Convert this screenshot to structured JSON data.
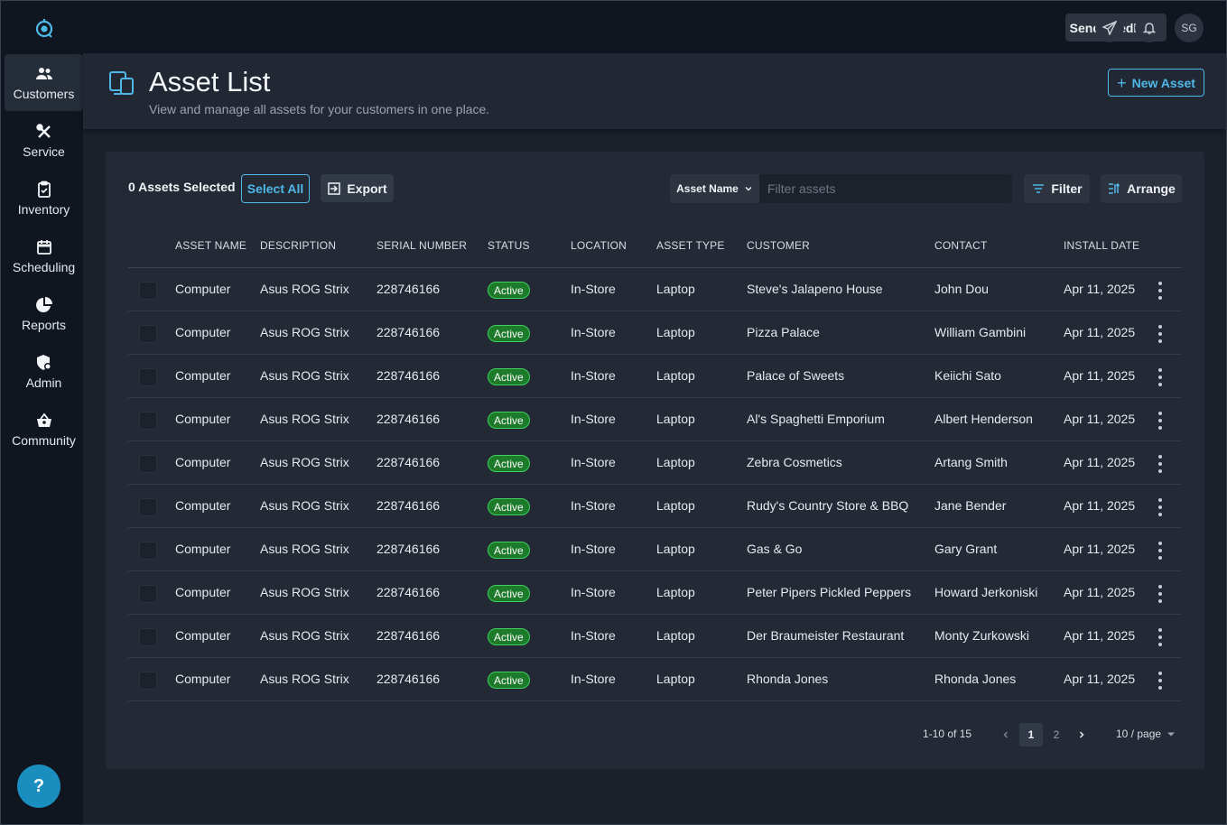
{
  "sidebar": {
    "items": [
      {
        "label": "Customers",
        "icon": "people-icon",
        "active": true
      },
      {
        "label": "Service",
        "icon": "tools-icon",
        "active": false
      },
      {
        "label": "Inventory",
        "icon": "clipboard-icon",
        "active": false
      },
      {
        "label": "Scheduling",
        "icon": "calendar-icon",
        "active": false
      },
      {
        "label": "Reports",
        "icon": "pie-chart-icon",
        "active": false
      },
      {
        "label": "Admin",
        "icon": "admin-gear-icon",
        "active": false
      },
      {
        "label": "Community",
        "icon": "basket-icon",
        "active": false
      }
    ],
    "help_label": "?"
  },
  "topbar": {
    "send_feedback": "Send Feedback",
    "avatar_initials": "SG"
  },
  "header": {
    "title": "Asset List",
    "subtitle": "View and manage all assets for your customers in one place.",
    "new_asset": "New Asset"
  },
  "toolbar": {
    "selected_count": "0 Assets Selected",
    "select_all": "Select All",
    "export": "Export",
    "search_field": "Asset Name",
    "search_placeholder": "Filter assets",
    "filter": "Filter",
    "arrange": "Arrange"
  },
  "table": {
    "columns": [
      "ASSET NAME",
      "DESCRIPTION",
      "SERIAL NUMBER",
      "STATUS",
      "LOCATION",
      "ASSET TYPE",
      "CUSTOMER",
      "CONTACT",
      "INSTALL DATE"
    ],
    "rows": [
      {
        "name": "Computer",
        "description": "Asus ROG Strix",
        "serial": "228746166",
        "status": "Active",
        "location": "In-Store",
        "type": "Laptop",
        "customer": "Steve's Jalapeno House",
        "contact": "John Dou",
        "date": "Apr 11, 2025"
      },
      {
        "name": "Computer",
        "description": "Asus ROG Strix",
        "serial": "228746166",
        "status": "Active",
        "location": "In-Store",
        "type": "Laptop",
        "customer": "Pizza Palace",
        "contact": "William Gambini",
        "date": "Apr 11, 2025"
      },
      {
        "name": "Computer",
        "description": "Asus ROG Strix",
        "serial": "228746166",
        "status": "Active",
        "location": "In-Store",
        "type": "Laptop",
        "customer": "Palace of Sweets",
        "contact": "Keiichi Sato",
        "date": "Apr 11, 2025"
      },
      {
        "name": "Computer",
        "description": "Asus ROG Strix",
        "serial": "228746166",
        "status": "Active",
        "location": "In-Store",
        "type": "Laptop",
        "customer": "Al's Spaghetti Emporium",
        "contact": "Albert Henderson",
        "date": "Apr 11, 2025"
      },
      {
        "name": "Computer",
        "description": "Asus ROG Strix",
        "serial": "228746166",
        "status": "Active",
        "location": "In-Store",
        "type": "Laptop",
        "customer": "Zebra Cosmetics",
        "contact": "Artang Smith",
        "date": "Apr 11, 2025"
      },
      {
        "name": "Computer",
        "description": "Asus ROG Strix",
        "serial": "228746166",
        "status": "Active",
        "location": "In-Store",
        "type": "Laptop",
        "customer": "Rudy's Country Store & BBQ",
        "contact": "Jane Bender",
        "date": "Apr 11, 2025"
      },
      {
        "name": "Computer",
        "description": "Asus ROG Strix",
        "serial": "228746166",
        "status": "Active",
        "location": "In-Store",
        "type": "Laptop",
        "customer": "Gas & Go",
        "contact": "Gary Grant",
        "date": "Apr 11, 2025"
      },
      {
        "name": "Computer",
        "description": "Asus ROG Strix",
        "serial": "228746166",
        "status": "Active",
        "location": "In-Store",
        "type": "Laptop",
        "customer": "Peter Pipers Pickled Peppers",
        "contact": "Howard Jerkoniski",
        "date": "Apr 11, 2025"
      },
      {
        "name": "Computer",
        "description": "Asus ROG Strix",
        "serial": "228746166",
        "status": "Active",
        "location": "In-Store",
        "type": "Laptop",
        "customer": "Der Braumeister Restaurant",
        "contact": "Monty Zurkowski",
        "date": "Apr 11, 2025"
      },
      {
        "name": "Computer",
        "description": "Asus ROG Strix",
        "serial": "228746166",
        "status": "Active",
        "location": "In-Store",
        "type": "Laptop",
        "customer": "Rhonda Jones",
        "contact": "Rhonda Jones",
        "date": "Apr 11, 2025"
      }
    ]
  },
  "pagination": {
    "range": "1-10 of 15",
    "pages": [
      "1",
      "2"
    ],
    "current_page": "1",
    "page_size": "10 / page"
  },
  "colors": {
    "accent": "#4fb8e8",
    "active_badge": "#1c7a2a",
    "background": "#1b212b"
  }
}
